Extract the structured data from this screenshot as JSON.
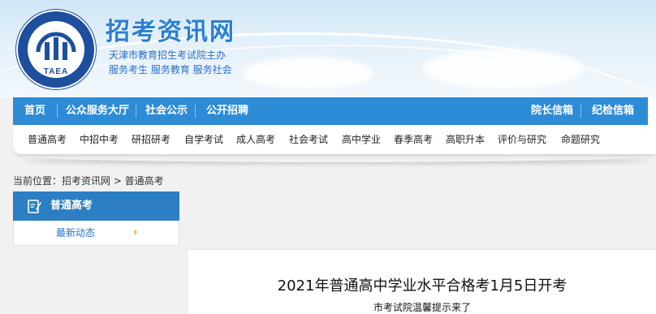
{
  "header": {
    "site_title": "招考资讯网",
    "subtitle_line1": "天津市教育招生考试院主办",
    "subtitle_line2": "服务考生 服务教育 服务社会",
    "logo_text": "TAEA"
  },
  "main_nav": {
    "left": [
      "首页",
      "公众服务大厅",
      "社会公示",
      "公开招聘"
    ],
    "right": [
      "院长信箱",
      "纪检信箱"
    ]
  },
  "sub_nav": [
    "普通高考",
    "中招中考",
    "研招研考",
    "自学考试",
    "成人高考",
    "社会考试",
    "高中学业",
    "春季高考",
    "高职升本",
    "评价与研究",
    "命题研究"
  ],
  "breadcrumb": "当前位置：招考资讯网 > 普通高考",
  "sidebar": {
    "title": "普通高考",
    "items": [
      {
        "label": "最新动态",
        "arrow": "›"
      }
    ]
  },
  "article": {
    "title": "2021年普通高中学业水平合格考1月5日开考",
    "subtitle": "市考试院温馨提示来了"
  },
  "colors": {
    "nav_blue": "#2e8bd6",
    "sidebar_blue": "#2c7fc3",
    "title_blue": "#2a7fd0",
    "accent_orange": "#ff8a00"
  }
}
